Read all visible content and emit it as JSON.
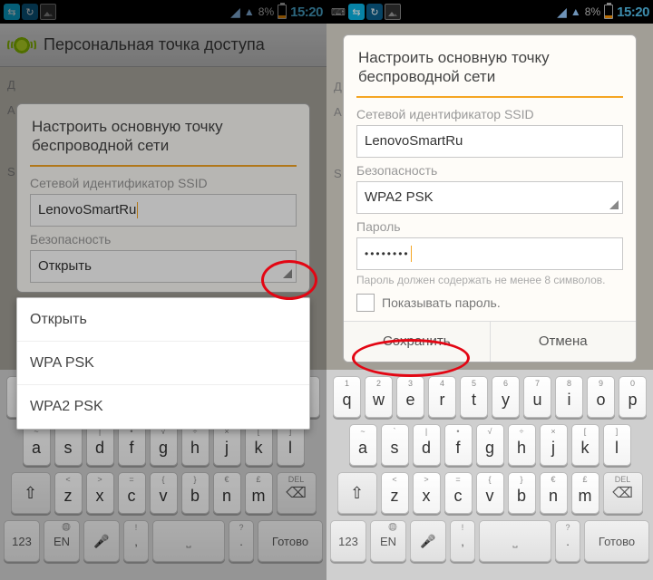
{
  "status": {
    "battery_pct": "8%",
    "time": "15:20"
  },
  "page": {
    "title": "Персональная точка доступа"
  },
  "edge": {
    "d": "Д",
    "a": "А",
    "s": "S"
  },
  "dialog": {
    "title": "Настроить основную точку беспроводной сети",
    "ssid_label": "Сетевой идентификатор SSID",
    "ssid_value": "LenovoSmartRu",
    "security_label": "Безопасность",
    "security_value_open": "Открыть",
    "security_value_wpa2": "WPA2 PSK",
    "password_label": "Пароль",
    "password_value": "••••••••",
    "password_hint": "Пароль должен содержать не менее 8 символов.",
    "show_password": "Показывать пароль.",
    "save": "Сохранить",
    "cancel": "Отмена"
  },
  "dropdown": [
    "Открыть",
    "WPA PSK",
    "WPA2 PSK"
  ],
  "keyboard": {
    "row1_sup": [
      "1",
      "2",
      "3",
      "4",
      "5",
      "6",
      "7",
      "8",
      "9",
      "0"
    ],
    "row1": [
      "q",
      "w",
      "e",
      "r",
      "t",
      "y",
      "u",
      "i",
      "o",
      "p"
    ],
    "row2_sup": [
      "~",
      "`",
      "|",
      "•",
      "√",
      "÷",
      "×",
      "[",
      "]"
    ],
    "row2": [
      "a",
      "s",
      "d",
      "f",
      "g",
      "h",
      "j",
      "k",
      "l"
    ],
    "row3_sup": [
      "<",
      ">",
      "=",
      "{",
      "}",
      "€",
      "£"
    ],
    "row3": [
      "z",
      "x",
      "c",
      "v",
      "b",
      "n",
      "m"
    ],
    "del": "DEL",
    "num": "123",
    "lang": "EN",
    "done": "Готово",
    "period": ".",
    "comma": ","
  }
}
